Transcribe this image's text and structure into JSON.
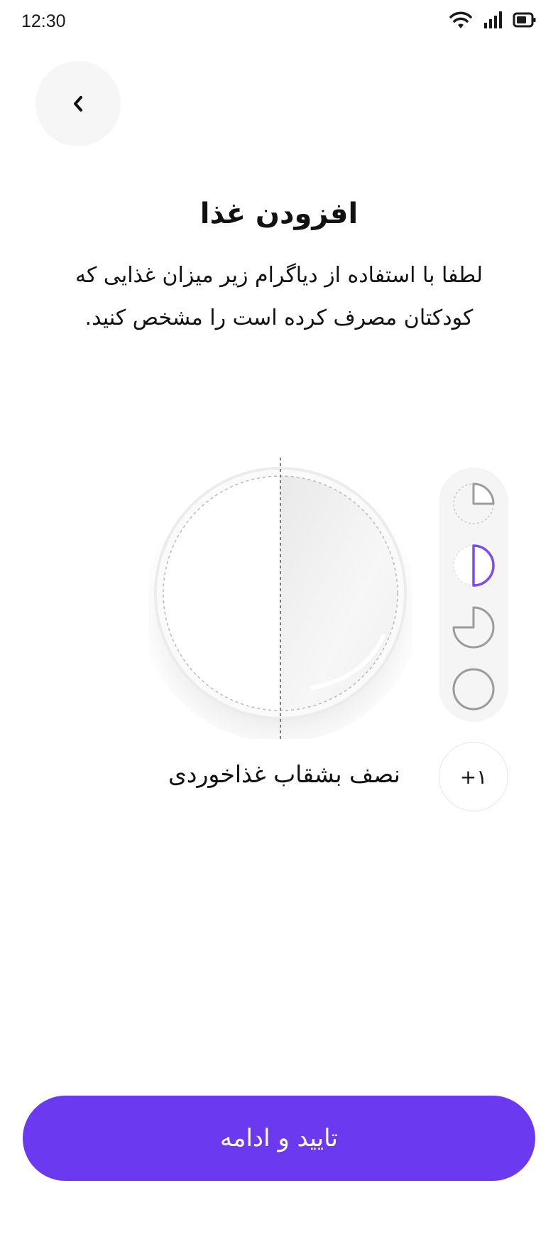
{
  "status_bar": {
    "time": "12:30"
  },
  "header": {
    "title": "افزودن غذا",
    "subtitle": "لطفا با استفاده از دیاگرام زیر میزان غذایی که کودکتان مصرف کرده است را مشخص کنید."
  },
  "portion": {
    "selected_label": "نصف بشقاب غذاخوردی",
    "plus_label": "+۱",
    "options": [
      "quarter",
      "half",
      "three-quarter",
      "full"
    ],
    "selected_option": "half",
    "selected_fraction": 0.5
  },
  "footer": {
    "confirm_label": "تایید و ادامه"
  },
  "colors": {
    "accent": "#6b3af0",
    "panel_bg": "#f5f5f6"
  }
}
